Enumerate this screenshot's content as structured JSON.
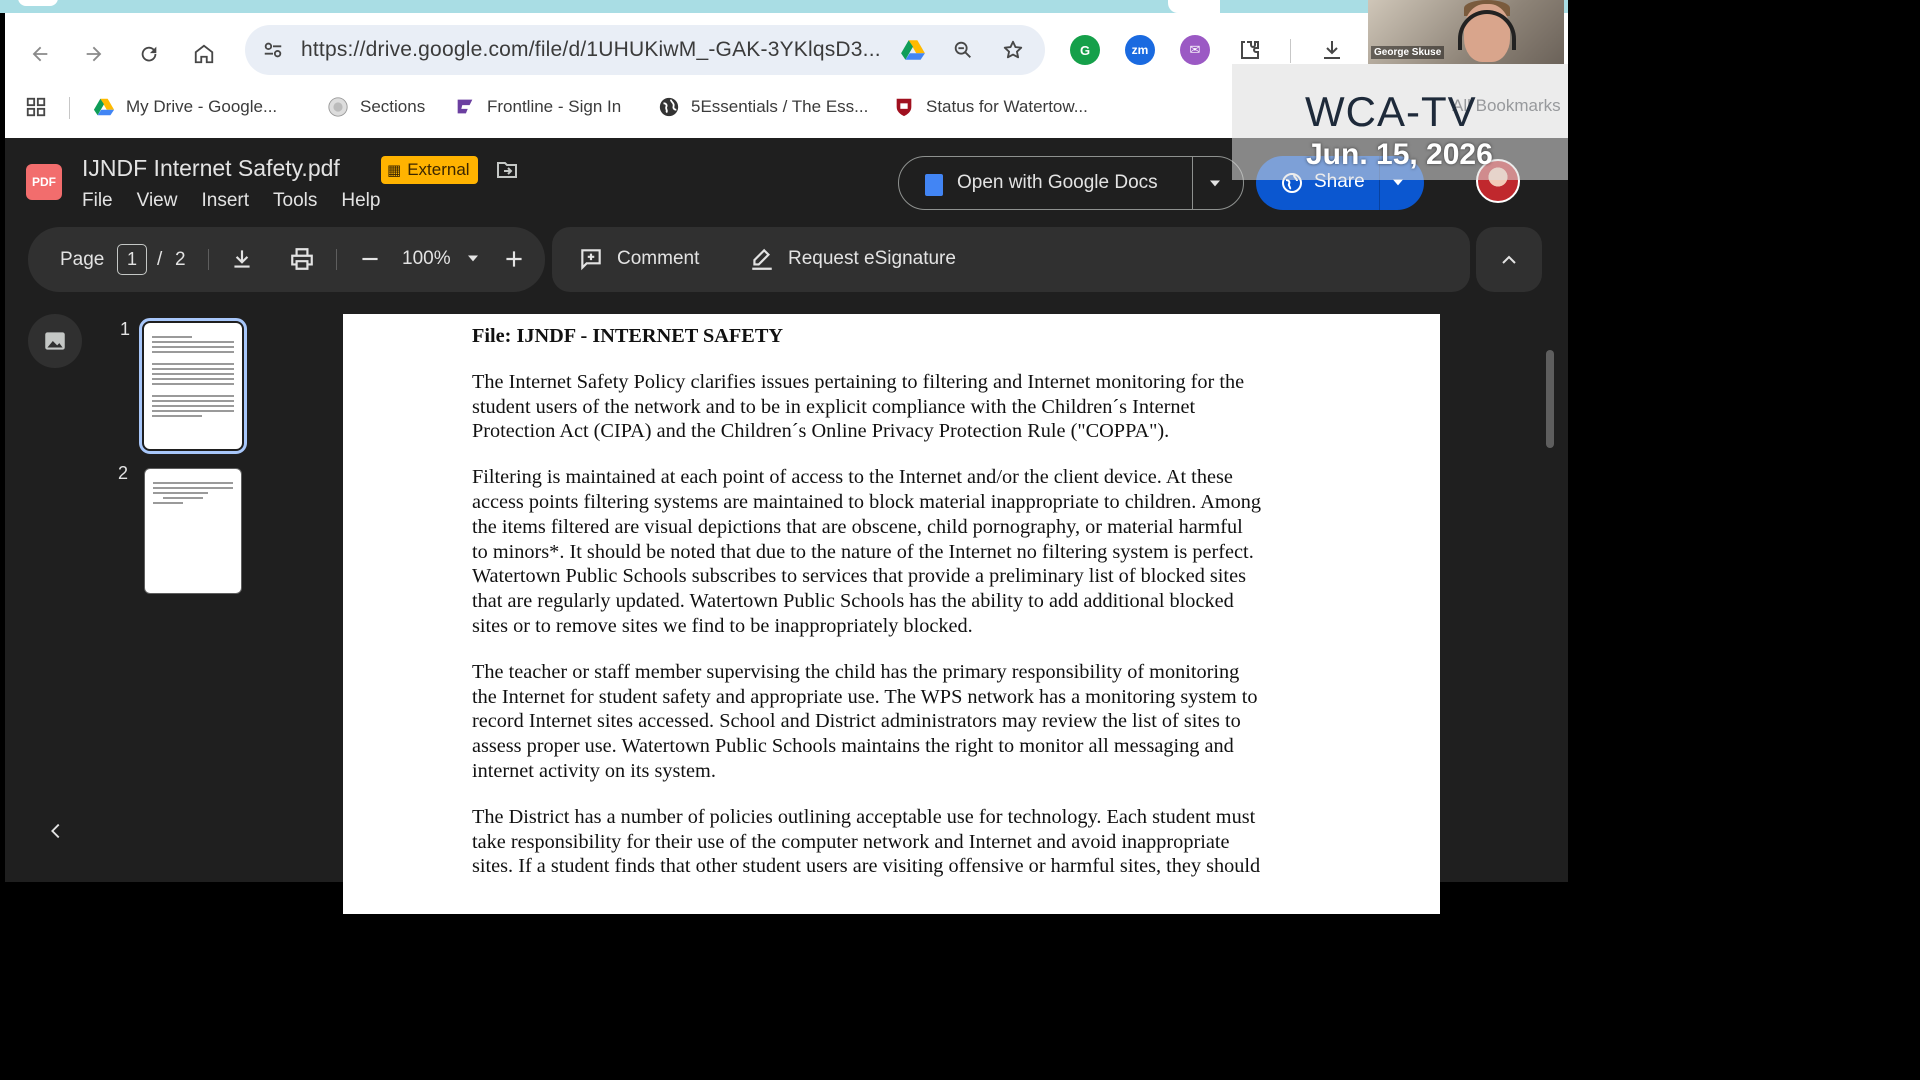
{
  "browser": {
    "url": "https://drive.google.com/file/d/1UHUKiwM_-GAK-3YKlqsD3...",
    "bookmarks": [
      {
        "label": "My Drive - Google...",
        "icon": "google-drive-icon"
      },
      {
        "label": "Sections",
        "icon": "seal-icon"
      },
      {
        "label": "Frontline - Sign In",
        "icon": "frontline-icon"
      },
      {
        "label": "5Essentials / The Ess...",
        "icon": "globe-icon"
      },
      {
        "label": "Status for Watertow...",
        "icon": "shield-crest-icon"
      }
    ],
    "all_bookmarks_label": "All Bookmarks"
  },
  "viewer": {
    "file_badge": "PDF",
    "title": "IJNDF Internet Safety.pdf",
    "external_badge": "External",
    "menu": [
      "File",
      "View",
      "Insert",
      "Tools",
      "Help"
    ],
    "open_with_label": "Open with Google Docs",
    "share_label": "Share",
    "toolbar": {
      "page_label": "Page",
      "current_page": "1",
      "page_separator": "/",
      "total_pages": "2",
      "zoom": "100%",
      "comment_label": "Comment",
      "esign_label": "Request eSignature"
    },
    "thumbnails": [
      "1",
      "2"
    ]
  },
  "document": {
    "heading": "File: IJNDF - INTERNET SAFETY",
    "paragraphs": [
      [
        "The Internet Safety Policy clarifies issues pertaining to filtering and Internet monitoring for the",
        "student users of the network and to be in explicit compliance with the Children´s Internet",
        "Protection Act (CIPA) and the Children´s Online Privacy Protection Rule (\"COPPA\")."
      ],
      [
        "Filtering is maintained at each point of access to the Internet and/or the client device. At these",
        "access points filtering systems are maintained to block material inappropriate to children. Among",
        "the items filtered are visual depictions that are obscene, child pornography, or material harmful",
        "to minors*. It should be noted that due to the nature of the Internet no filtering system is perfect.",
        "Watertown Public Schools subscribes to services that provide a preliminary list of blocked sites",
        "that are regularly updated. Watertown Public Schools has the ability to add additional blocked",
        "sites or to remove sites we find to be inappropriately blocked."
      ],
      [
        "The teacher or staff member supervising the child has the primary responsibility of monitoring",
        "the Internet for student safety and appropriate use. The WPS network has a monitoring system to",
        "record Internet sites accessed. School and District administrators may review the list of sites to",
        "assess proper use. Watertown Public Schools maintains the right to monitor all messaging and",
        "internet activity on its system."
      ],
      [
        "The District has a number of policies outlining acceptable use for technology. Each student must",
        "take responsibility for their use of the computer network and Internet and avoid inappropriate",
        "sites. If a student finds that other student users are visiting offensive or harmful sites, they should"
      ]
    ]
  },
  "overlay": {
    "camera_name": "George Skuse",
    "station": "WCA-TV",
    "date": "Jun. 15, 2026"
  },
  "colors": {
    "viewer_bg": "#1f1f1f",
    "toolbar_bg": "#303030",
    "share_blue": "#0b57d0",
    "external_badge": "#ffb300",
    "pdf_badge": "#f26d6d"
  }
}
